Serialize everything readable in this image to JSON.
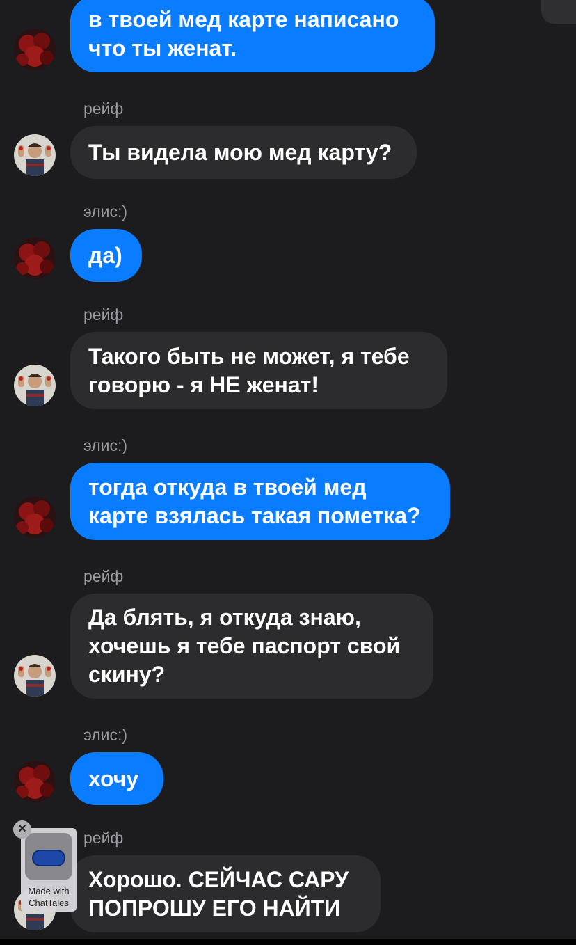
{
  "messages": [
    {
      "sender": "",
      "text": "в твоей мед карте написано\nчто ты женат.",
      "side": "me"
    },
    {
      "sender": "рейф",
      "text": "Ты видела мою мед карту?",
      "side": "other"
    },
    {
      "sender": "элис:)",
      "text": "да)",
      "side": "me"
    },
    {
      "sender": "рейф",
      "text": "Такого быть не может, я тебе\nговорю - я НЕ женат!",
      "side": "other"
    },
    {
      "sender": "элис:)",
      "text": "тогда откуда в твоей мед\nкарте взялась такая пометка?",
      "side": "me"
    },
    {
      "sender": "рейф",
      "text": "Да блять, я откуда знаю,\nхочешь я тебе паспорт свой\nскину?",
      "side": "other"
    },
    {
      "sender": "элис:)",
      "text": "хочу",
      "side": "me"
    },
    {
      "sender": "рейф",
      "text": "Хорошо. СЕЙЧАС САРУ\nПОПРОШУ ЕГО НАЙТИ",
      "side": "other"
    }
  ],
  "watermark": {
    "caption": "Made with\nChatTales",
    "close_icon": "×"
  },
  "colors": {
    "my_bubble": "#0a7cff",
    "other_bubble": "#2c2c2e",
    "background": "#1c1c1e"
  }
}
